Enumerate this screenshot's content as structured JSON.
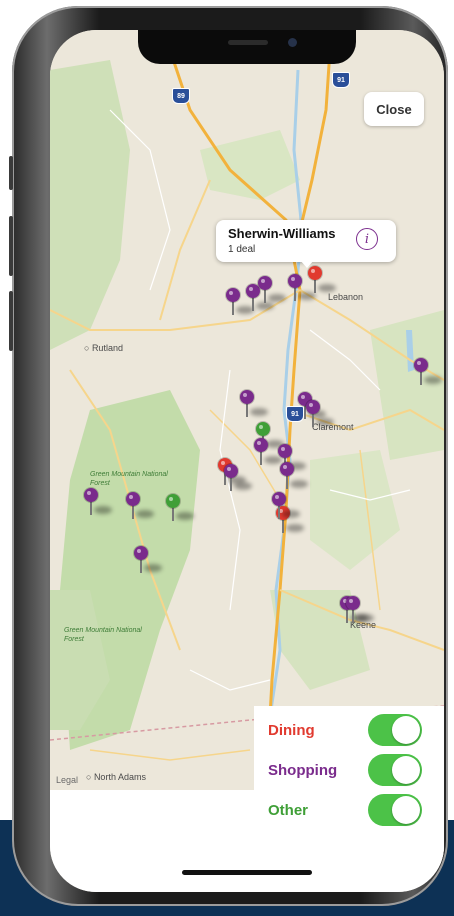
{
  "colors": {
    "dining": "#e13a2f",
    "shopping": "#7a2b8c",
    "other": "#3f9f37",
    "toggle_on": "#4cc248",
    "navy_band": "#0d3155"
  },
  "map": {
    "close_label": "Close",
    "legal_label": "Legal",
    "callout": {
      "title": "Sherwin-Williams",
      "subtitle": "1 deal",
      "info_icon": "info-circle-icon"
    },
    "place_labels": {
      "rutland": "Rutland",
      "lebanon": "Lebanon",
      "claremont": "Claremont",
      "keene": "Keene",
      "north_adams": "North Adams"
    },
    "forest_labels": {
      "green_mountain_north": "Green Mountain National Forest",
      "green_mountain_south": "Green Mountain National Forest"
    },
    "shields": {
      "i89": "89",
      "i91_top": "91",
      "i91_mid": "91",
      "i91_bottom": "91"
    },
    "pins": [
      {
        "category": "shopping"
      },
      {
        "category": "shopping"
      },
      {
        "category": "shopping"
      },
      {
        "category": "shopping"
      },
      {
        "category": "dining"
      },
      {
        "category": "shopping"
      },
      {
        "category": "shopping"
      },
      {
        "category": "other"
      },
      {
        "category": "shopping"
      },
      {
        "category": "shopping"
      },
      {
        "category": "shopping"
      },
      {
        "category": "shopping"
      },
      {
        "category": "dining"
      },
      {
        "category": "shopping"
      },
      {
        "category": "shopping"
      },
      {
        "category": "dining"
      },
      {
        "category": "shopping"
      },
      {
        "category": "shopping"
      },
      {
        "category": "other"
      },
      {
        "category": "shopping"
      },
      {
        "category": "shopping"
      },
      {
        "category": "shopping"
      },
      {
        "category": "shopping"
      }
    ]
  },
  "filters": [
    {
      "label": "Dining",
      "enabled": true
    },
    {
      "label": "Shopping",
      "enabled": true
    },
    {
      "label": "Other",
      "enabled": true
    }
  ]
}
